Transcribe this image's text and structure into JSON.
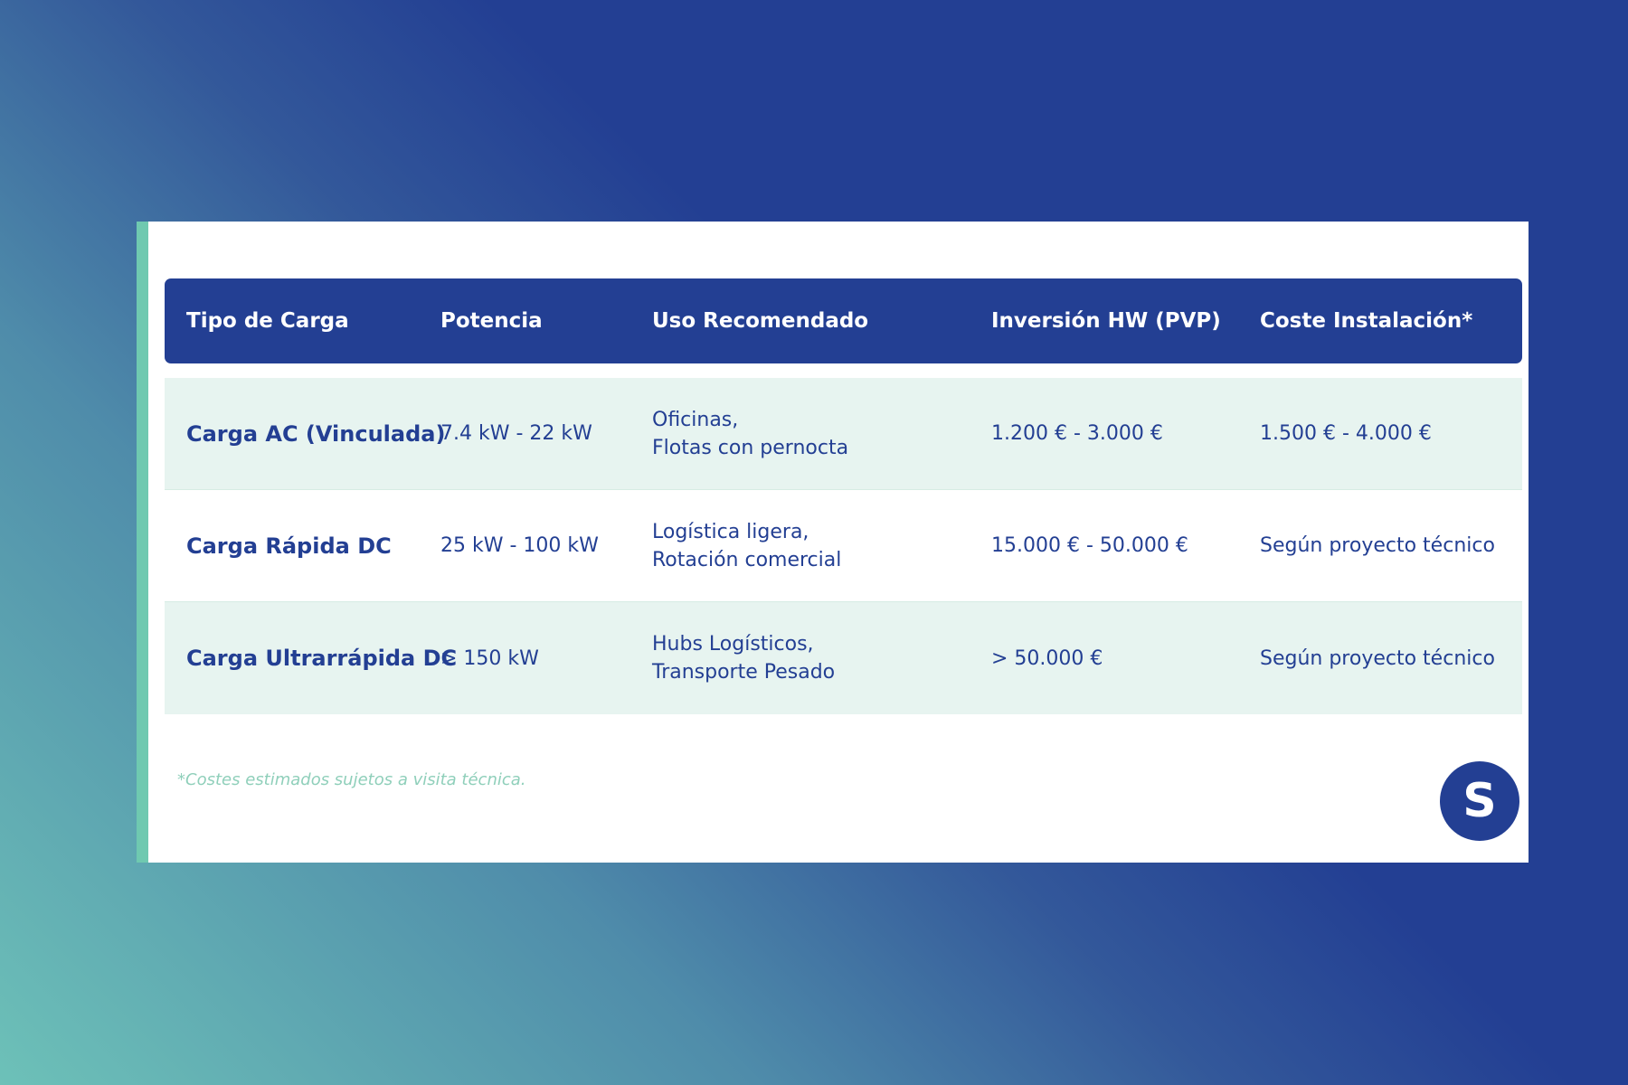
{
  "table": {
    "headers": [
      "Tipo de Carga",
      "Potencia",
      "Uso Recomendado",
      "Inversión HW (PVP)",
      "Coste Instalación*"
    ],
    "rows": [
      {
        "tipo": "Carga AC (Vinculada)",
        "potencia": "7.4 kW - 22 kW",
        "uso_line1": "Oficinas,",
        "uso_line2": "Flotas con pernocta",
        "inversion": "1.200 € - 3.000 €",
        "coste": "1.500 € - 4.000 €"
      },
      {
        "tipo": "Carga Rápida DC",
        "potencia": "25 kW - 100 kW",
        "uso_line1": "Logística ligera,",
        "uso_line2": "Rotación comercial",
        "inversion": "15.000 € - 50.000 €",
        "coste": "Según proyecto técnico"
      },
      {
        "tipo": "Carga Ultrarrápida DC",
        "potencia": "> 150 kW",
        "uso_line1": "Hubs Logísticos,",
        "uso_line2": "Transporte Pesado",
        "inversion": "> 50.000 €",
        "coste": "Según proyecto técnico"
      }
    ]
  },
  "footnote": "*Costes estimados sujetos a visita técnica.",
  "logo": {
    "letter": "S"
  },
  "colors": {
    "primary": "#233f93",
    "accent": "#6fc9b0",
    "row_alt": "#e7f4f0",
    "footnote": "#8fcfba"
  }
}
